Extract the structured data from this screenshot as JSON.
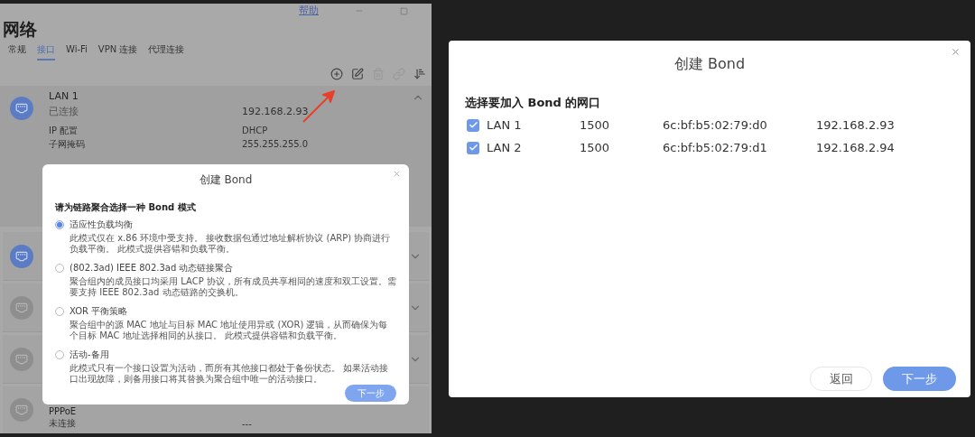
{
  "network_window": {
    "help_link": "帮助",
    "title": "网络",
    "tabs": [
      {
        "label": "常规",
        "selected": false
      },
      {
        "label": "接口",
        "selected": true
      },
      {
        "label": "Wi-Fi",
        "selected": false
      },
      {
        "label": "VPN 连接",
        "selected": false
      },
      {
        "label": "代理连接",
        "selected": false
      }
    ],
    "toolbar": [
      {
        "kind": "add",
        "disabled": false
      },
      {
        "kind": "edit",
        "disabled": false
      },
      {
        "kind": "delete",
        "disabled": true
      },
      {
        "kind": "link",
        "disabled": true
      },
      {
        "kind": "sort",
        "disabled": false
      }
    ],
    "interfaces": [
      {
        "name": "LAN 1",
        "status": "已连接",
        "ip": "192.168.2.93",
        "connected": true,
        "expanded": true,
        "details": [
          {
            "label": "IP 配置",
            "value": "DHCP"
          },
          {
            "label": "子网掩码",
            "value": "255.255.255.0"
          }
        ]
      },
      {
        "connected": true,
        "expanded": false
      },
      {
        "connected": false,
        "expanded": false
      },
      {
        "connected": false,
        "expanded": false
      },
      {
        "name": "PPPoE",
        "status": "未连接",
        "ip": "---",
        "connected": false
      }
    ]
  },
  "bond_mode_dialog": {
    "title": "创建 Bond",
    "heading": "请为链路聚合选择一种 Bond 模式",
    "options": [
      {
        "label": "适应性负载均衡",
        "description": "此模式仅在 x.86 环境中受支持。 接收数据包通过地址解析协议 (ARP) 协商进行负载平衡。 此模式提供容错和负载平衡。",
        "selected": true
      },
      {
        "label": "(802.3ad) IEEE 802.3ad 动态链接聚合",
        "description": "聚合组内的成员接口均采用 LACP 协议，所有成员共享相同的速度和双工设置。需要支持 IEEE 802.3ad 动态链路的交换机。",
        "selected": false
      },
      {
        "label": "XOR 平衡策略",
        "description": "聚合组中的源 MAC 地址与目标 MAC 地址使用异或 (XOR) 逻辑，从而确保为每个目标 MAC 地址选择相同的从接口。 此模式提供容错和负载平衡。",
        "selected": false
      },
      {
        "label": "活动-备用",
        "description": "此模式只有一个接口设置为活动，而所有其他接口都处于备份状态。 如果活动接口出现故障，则备用接口将其替换为聚合组中唯一的活动接口。",
        "selected": false
      }
    ],
    "next_button": "下一步"
  },
  "bond_ports_dialog": {
    "title": "创建 Bond",
    "heading": "选择要加入 Bond 的网口",
    "ports": [
      {
        "name": "LAN 1",
        "mtu": "1500",
        "mac": "6c:bf:b5:02:79:d0",
        "ip": "192.168.2.93",
        "checked": true
      },
      {
        "name": "LAN 2",
        "mtu": "1500",
        "mac": "6c:bf:b5:02:79:d1",
        "ip": "192.168.2.94",
        "checked": true
      }
    ],
    "back_button": "返回",
    "next_button": "下一步"
  }
}
